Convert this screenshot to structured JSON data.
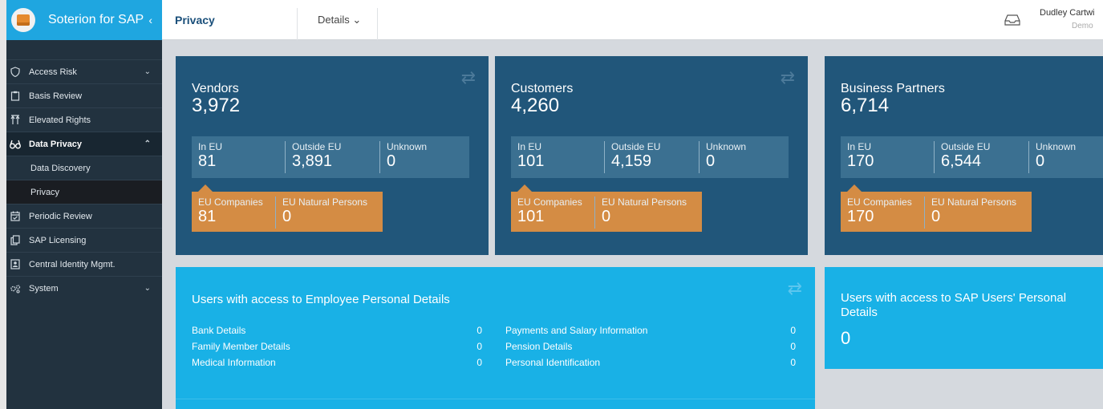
{
  "brand": {
    "title": "Soterion for SAP",
    "collapse": "‹"
  },
  "nav": {
    "items": [
      {
        "label": "Access Risk",
        "icon": "shield-icon",
        "chev": "⌄"
      },
      {
        "label": "Basis Review",
        "icon": "clipboard-icon"
      },
      {
        "label": "Elevated Rights",
        "icon": "arrows-up-icon"
      },
      {
        "label": "Data Privacy",
        "icon": "glasses-icon",
        "chev": "⌃"
      },
      {
        "label": "Data Discovery"
      },
      {
        "label": "Privacy"
      },
      {
        "label": "Periodic Review",
        "icon": "calendar-check-icon"
      },
      {
        "label": "SAP Licensing",
        "icon": "copy-icon"
      },
      {
        "label": "Central Identity Mgmt.",
        "icon": "id-card-icon"
      },
      {
        "label": "System",
        "icon": "gears-icon",
        "chev": "⌄"
      }
    ]
  },
  "topbar": {
    "title": "Privacy",
    "details": "Details ⌄",
    "user": "Dudley Cartwi",
    "role": "Demo"
  },
  "cards": [
    {
      "title": "Vendors",
      "total": "3,972",
      "in_eu_label": "In EU",
      "in_eu": "81",
      "outside_label": "Outside EU",
      "outside": "3,891",
      "unknown_label": "Unknown",
      "unknown": "0",
      "companies_label": "EU Companies",
      "companies": "81",
      "persons_label": "EU Natural Persons",
      "persons": "0"
    },
    {
      "title": "Customers",
      "total": "4,260",
      "in_eu_label": "In EU",
      "in_eu": "101",
      "outside_label": "Outside EU",
      "outside": "4,159",
      "unknown_label": "Unknown",
      "unknown": "0",
      "companies_label": "EU Companies",
      "companies": "101",
      "persons_label": "EU Natural Persons",
      "persons": "0"
    },
    {
      "title": "Business Partners",
      "total": "6,714",
      "in_eu_label": "In EU",
      "in_eu": "170",
      "outside_label": "Outside EU",
      "outside": "6,544",
      "unknown_label": "Unknown",
      "unknown": "0",
      "companies_label": "EU Companies",
      "companies": "170",
      "persons_label": "EU Natural Persons",
      "persons": "0"
    }
  ],
  "employee_panel": {
    "title": "Users with access to Employee Personal Details",
    "left": [
      {
        "label": "Bank Details",
        "value": "0"
      },
      {
        "label": "Family Member Details",
        "value": "0"
      },
      {
        "label": "Medical Information",
        "value": "0"
      }
    ],
    "right": [
      {
        "label": "Payments and Salary Information",
        "value": "0"
      },
      {
        "label": "Pension Details",
        "value": "0"
      },
      {
        "label": "Personal Identification",
        "value": "0"
      }
    ]
  },
  "sap_panel": {
    "title_line1": "Users with access to SAP Users' Personal",
    "title_line2": "Details",
    "value": "0"
  },
  "colors": {
    "brand": "#1fa6e0",
    "sidebar": "#22323f",
    "card": "#21567a",
    "eu_orange": "#d48c44",
    "panel": "#19b1e6"
  }
}
